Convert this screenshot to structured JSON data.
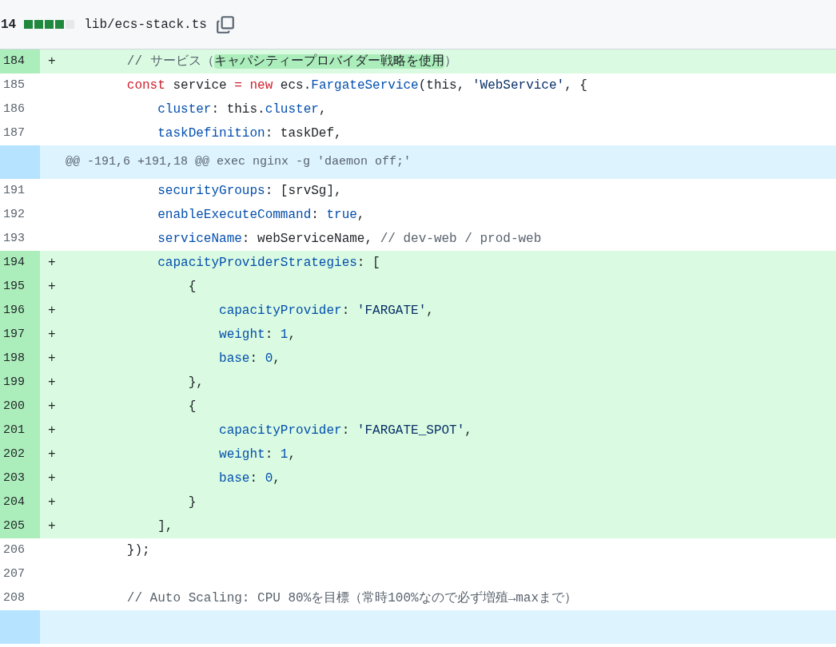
{
  "file_header": {
    "changes_count": "14",
    "stat_blocks": [
      {
        "filled": true
      },
      {
        "filled": true
      },
      {
        "filled": true
      },
      {
        "filled": true
      },
      {
        "filled": false
      }
    ],
    "path": "lib/ecs-stack.ts"
  },
  "lines": [
    {
      "kind": "added",
      "number": "184",
      "sign": "+",
      "tokens": [
        {
          "kind": "comment",
          "text": "        // サービス（"
        },
        {
          "kind": "comment-highlight",
          "text": "キャパシティープロバイダー戦略を使用"
        },
        {
          "kind": "comment",
          "text": "）"
        }
      ]
    },
    {
      "kind": "context",
      "number": "185",
      "tokens": [
        {
          "kind": "keyword",
          "text": "        const"
        },
        {
          "kind": "plain",
          "text": " service "
        },
        {
          "kind": "keyword",
          "text": "= new"
        },
        {
          "kind": "plain",
          "text": " ecs."
        },
        {
          "kind": "property",
          "text": "FargateService"
        },
        {
          "kind": "plain",
          "text": "(this, "
        },
        {
          "kind": "string",
          "text": "'WebService'"
        },
        {
          "kind": "plain",
          "text": ", {"
        }
      ]
    },
    {
      "kind": "context",
      "number": "186",
      "tokens": [
        {
          "kind": "property",
          "text": "            cluster"
        },
        {
          "kind": "plain",
          "text": ": this."
        },
        {
          "kind": "property",
          "text": "cluster"
        },
        {
          "kind": "plain",
          "text": ","
        }
      ]
    },
    {
      "kind": "context",
      "number": "187",
      "tokens": [
        {
          "kind": "property",
          "text": "            taskDefinition"
        },
        {
          "kind": "plain",
          "text": ": taskDef,"
        }
      ]
    },
    {
      "kind": "hunk",
      "text": "@@ -191,6 +191,18 @@ exec nginx -g 'daemon off;'"
    },
    {
      "kind": "context",
      "number": "191",
      "tokens": [
        {
          "kind": "property",
          "text": "            securityGroups"
        },
        {
          "kind": "plain",
          "text": ": [srvSg],"
        }
      ]
    },
    {
      "kind": "context",
      "number": "192",
      "tokens": [
        {
          "kind": "property",
          "text": "            enableExecuteCommand"
        },
        {
          "kind": "plain",
          "text": ": "
        },
        {
          "kind": "property",
          "text": "true"
        },
        {
          "kind": "plain",
          "text": ","
        }
      ]
    },
    {
      "kind": "context",
      "number": "193",
      "tokens": [
        {
          "kind": "property",
          "text": "            serviceName"
        },
        {
          "kind": "plain",
          "text": ": webServiceName, "
        },
        {
          "kind": "comment",
          "text": "// dev-web / prod-web"
        }
      ]
    },
    {
      "kind": "added",
      "number": "194",
      "sign": "+",
      "tokens": [
        {
          "kind": "property",
          "text": "            capacityProviderStrategies"
        },
        {
          "kind": "plain",
          "text": ": ["
        }
      ]
    },
    {
      "kind": "added",
      "number": "195",
      "sign": "+",
      "tokens": [
        {
          "kind": "plain",
          "text": "                {"
        }
      ]
    },
    {
      "kind": "added",
      "number": "196",
      "sign": "+",
      "tokens": [
        {
          "kind": "property",
          "text": "                    capacityProvider"
        },
        {
          "kind": "plain",
          "text": ": "
        },
        {
          "kind": "string",
          "text": "'FARGATE'"
        },
        {
          "kind": "plain",
          "text": ","
        }
      ]
    },
    {
      "kind": "added",
      "number": "197",
      "sign": "+",
      "tokens": [
        {
          "kind": "property",
          "text": "                    weight"
        },
        {
          "kind": "plain",
          "text": ": "
        },
        {
          "kind": "property",
          "text": "1"
        },
        {
          "kind": "plain",
          "text": ","
        }
      ]
    },
    {
      "kind": "added",
      "number": "198",
      "sign": "+",
      "tokens": [
        {
          "kind": "property",
          "text": "                    base"
        },
        {
          "kind": "plain",
          "text": ": "
        },
        {
          "kind": "property",
          "text": "0"
        },
        {
          "kind": "plain",
          "text": ","
        }
      ]
    },
    {
      "kind": "added",
      "number": "199",
      "sign": "+",
      "tokens": [
        {
          "kind": "plain",
          "text": "                },"
        }
      ]
    },
    {
      "kind": "added",
      "number": "200",
      "sign": "+",
      "tokens": [
        {
          "kind": "plain",
          "text": "                {"
        }
      ]
    },
    {
      "kind": "added",
      "number": "201",
      "sign": "+",
      "tokens": [
        {
          "kind": "property",
          "text": "                    capacityProvider"
        },
        {
          "kind": "plain",
          "text": ": "
        },
        {
          "kind": "string",
          "text": "'FARGATE_SPOT'"
        },
        {
          "kind": "plain",
          "text": ","
        }
      ]
    },
    {
      "kind": "added",
      "number": "202",
      "sign": "+",
      "tokens": [
        {
          "kind": "property",
          "text": "                    weight"
        },
        {
          "kind": "plain",
          "text": ": "
        },
        {
          "kind": "property",
          "text": "1"
        },
        {
          "kind": "plain",
          "text": ","
        }
      ]
    },
    {
      "kind": "added",
      "number": "203",
      "sign": "+",
      "tokens": [
        {
          "kind": "property",
          "text": "                    base"
        },
        {
          "kind": "plain",
          "text": ": "
        },
        {
          "kind": "property",
          "text": "0"
        },
        {
          "kind": "plain",
          "text": ","
        }
      ]
    },
    {
      "kind": "added",
      "number": "204",
      "sign": "+",
      "tokens": [
        {
          "kind": "plain",
          "text": "                }"
        }
      ]
    },
    {
      "kind": "added",
      "number": "205",
      "sign": "+",
      "tokens": [
        {
          "kind": "plain",
          "text": "            ],"
        }
      ]
    },
    {
      "kind": "context",
      "number": "206",
      "tokens": [
        {
          "kind": "plain",
          "text": "        });"
        }
      ]
    },
    {
      "kind": "context",
      "number": "207"
    },
    {
      "kind": "context",
      "number": "208",
      "tokens": [
        {
          "kind": "comment",
          "text": "        // Auto Scaling: CPU 80%を目標（常時100%なので必ず増殖→maxまで）"
        }
      ]
    },
    {
      "kind": "expand"
    }
  ]
}
